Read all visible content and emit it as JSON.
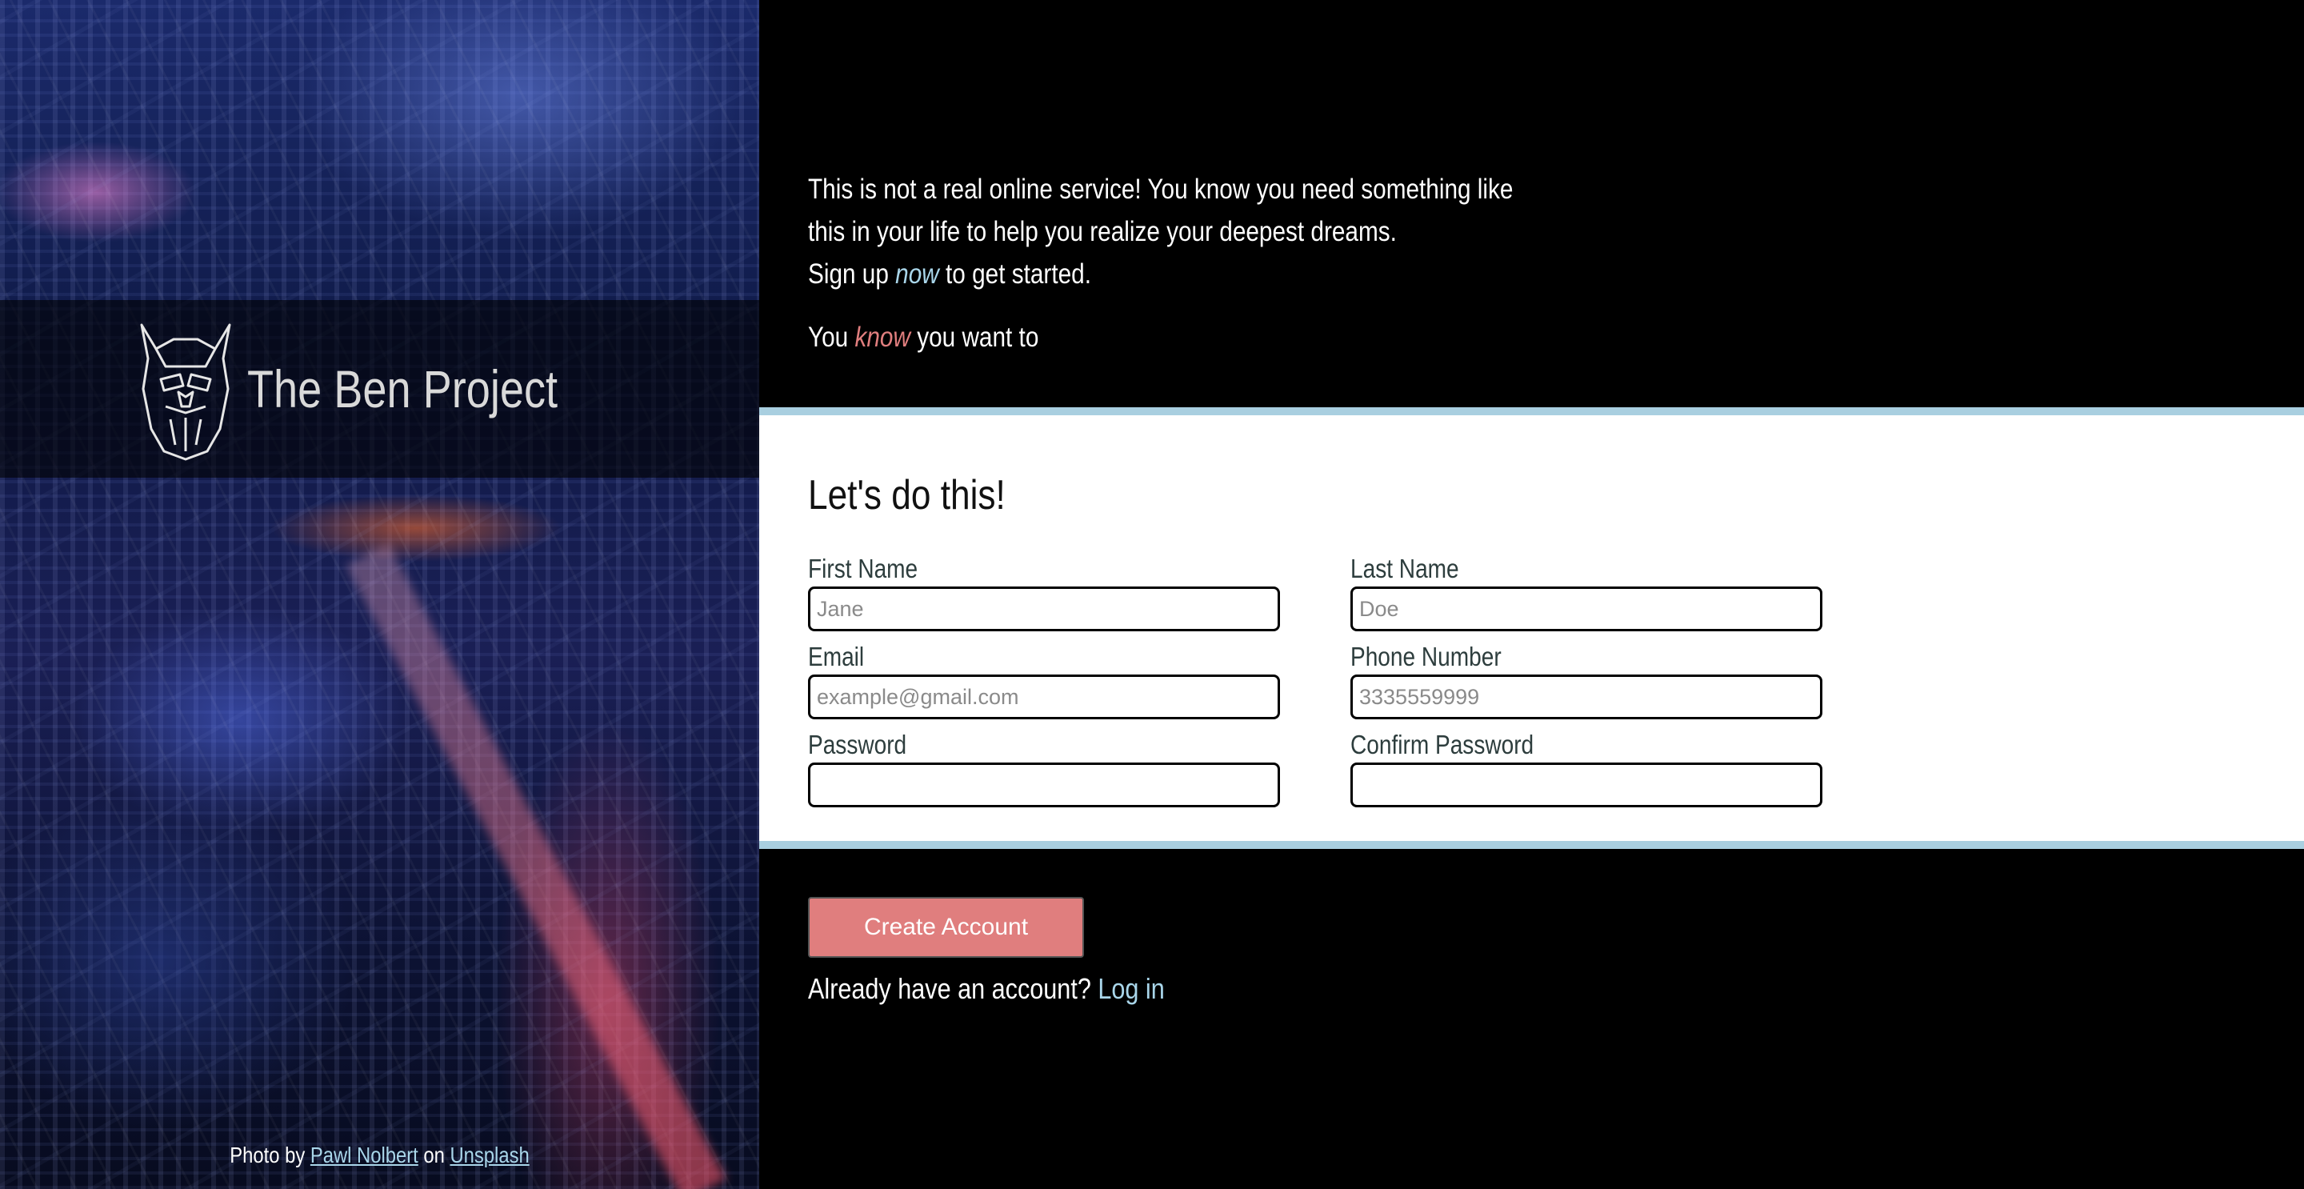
{
  "brand": {
    "name": "The Ben Project",
    "logo_icon": "viking-bearded-head-icon"
  },
  "credit": {
    "prefix": "Photo by",
    "author": "Pawl Nolbert",
    "middle": "on",
    "site": "Unsplash"
  },
  "intro": {
    "line1": "This is not a real online service! You know you need something like this in your life to help you realize your deepest dreams.",
    "signup_prefix": "Sign up",
    "signup_emph": "now",
    "signup_suffix": "to get started.",
    "tag_prefix": "You",
    "tag_emph": "know",
    "tag_suffix": "you want to"
  },
  "form": {
    "title": "Let's do this!",
    "fields": {
      "first_name": {
        "label": "First Name",
        "placeholder": "Jane"
      },
      "last_name": {
        "label": "Last Name",
        "placeholder": "Doe"
      },
      "email": {
        "label": "Email",
        "placeholder": "example@gmail.com"
      },
      "phone": {
        "label": "Phone Number",
        "placeholder": "3335559999"
      },
      "password": {
        "label": "Password",
        "placeholder": ""
      },
      "confirm_password": {
        "label": "Confirm Password",
        "placeholder": ""
      }
    }
  },
  "actions": {
    "create_label": "Create Account",
    "login_prompt": "Already have an account?",
    "login_link": "Log in"
  },
  "colors": {
    "accent_blue": "#a9d6ea",
    "accent_red": "#e07e7e",
    "divider": "#a9cfe0"
  }
}
